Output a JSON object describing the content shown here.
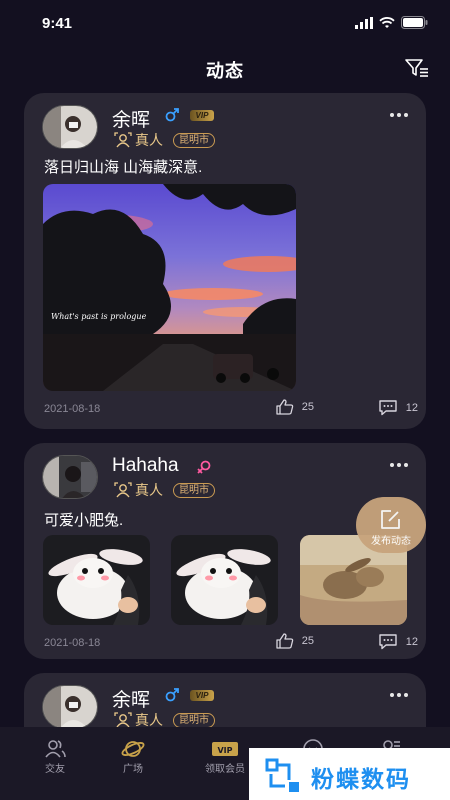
{
  "status_bar": {
    "time": "9:41"
  },
  "header": {
    "title": "动态"
  },
  "posts": [
    {
      "username": "余晖",
      "gender": "male",
      "vip": "VIP",
      "verified_label": "真人",
      "city": "昆明市",
      "text": "落日归山海 山海藏深意.",
      "photo_caption": "What's past is prologue",
      "date": "2021-08-18",
      "likes": "25",
      "comments": "12"
    },
    {
      "username": "Hahaha",
      "gender": "female",
      "verified_label": "真人",
      "city": "昆明市",
      "text": "可爱小肥兔.",
      "date": "2021-08-18",
      "likes": "25",
      "comments": "12"
    },
    {
      "username": "余晖",
      "gender": "male",
      "vip": "VIP",
      "verified_label": "真人",
      "city": "昆明市"
    }
  ],
  "fab": {
    "label": "发布动态"
  },
  "tabs": [
    {
      "label": "交友",
      "icon": "friends-icon"
    },
    {
      "label": "广场",
      "icon": "planet-icon"
    },
    {
      "label": "领取会员",
      "icon": "vip-icon"
    },
    {
      "label": "",
      "icon": "message-icon"
    },
    {
      "label": "",
      "icon": "profile-icon"
    }
  ],
  "watermark": {
    "text": "粉蝶数码",
    "icon": "butterfly-logo-icon"
  },
  "colors": {
    "background": "#131020",
    "card": "#2a2734",
    "accent_gold": "#c9a24a",
    "male_blue": "#3aa0ff",
    "female_pink": "#ff5aa0",
    "active_tab": "#c8a24a"
  }
}
